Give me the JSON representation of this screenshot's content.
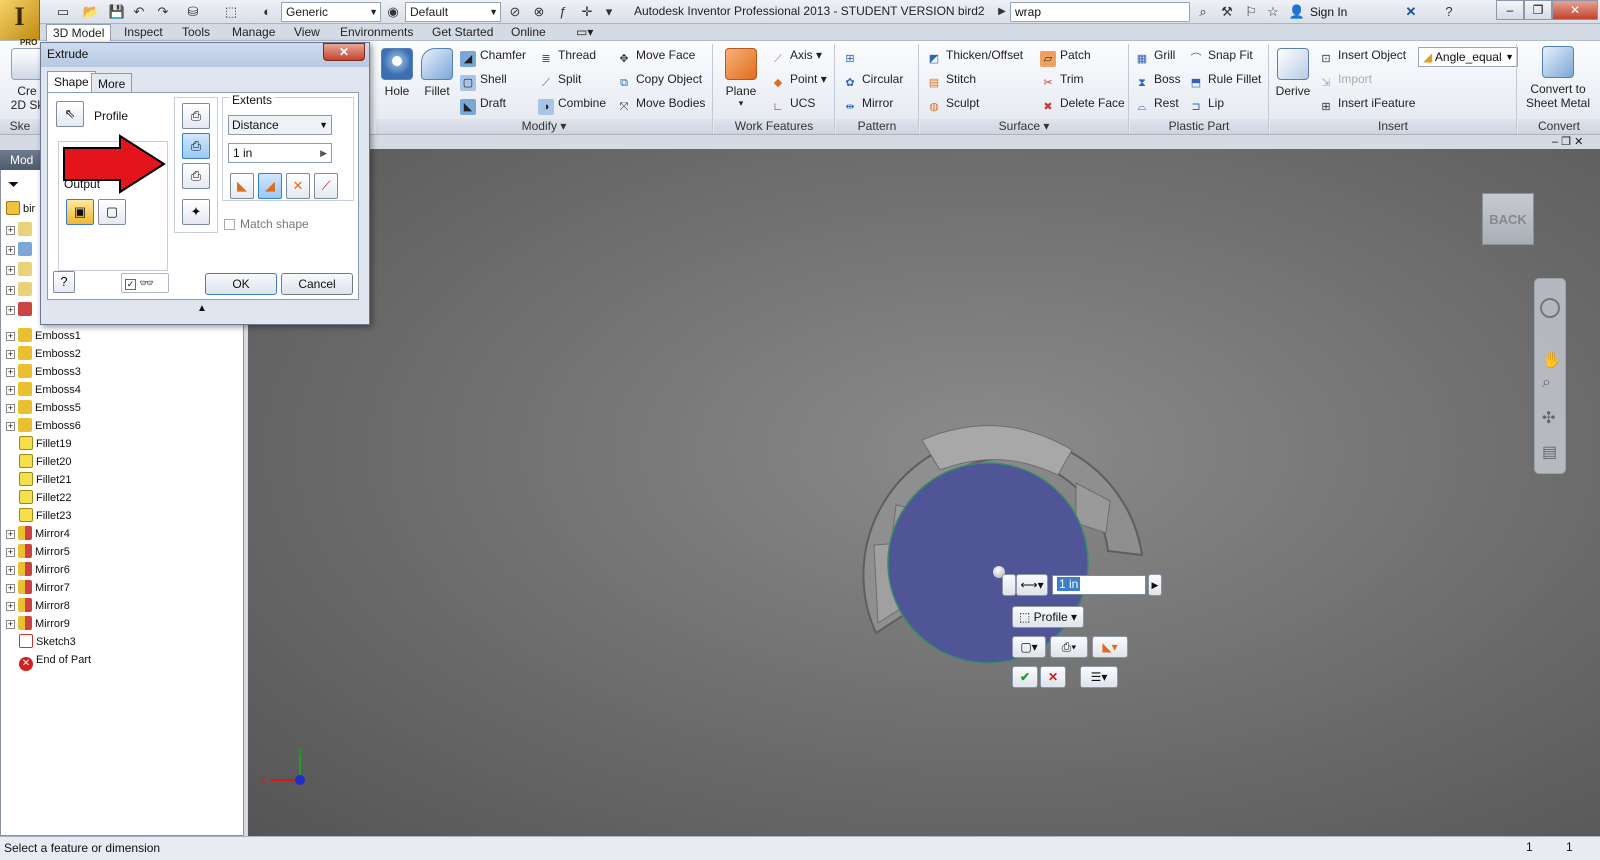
{
  "app": {
    "title": "Autodesk Inventor Professional 2013 - STUDENT VERSION    bird2",
    "logo_letter": "I",
    "logo_sub": "PRO",
    "appearance_combo": "Generic",
    "style_combo": "Default",
    "search_value": "wrap",
    "sign_in": "Sign In",
    "window_buttons": [
      "–",
      "❐",
      "✕"
    ],
    "help": "?"
  },
  "tabs": [
    "3D Model",
    "Inspect",
    "Tools",
    "Manage",
    "View",
    "Environments",
    "Get Started",
    "Online"
  ],
  "ribbon": {
    "sketch_partial": {
      "label1": "Cre",
      "label2": "2D Sk",
      "title": "Ske"
    },
    "modify": {
      "title": "Modify",
      "big": [
        "Hole",
        "Fillet"
      ],
      "col1": [
        "Chamfer",
        "Shell",
        "Draft"
      ],
      "col2": [
        "Thread",
        "Split",
        "Combine"
      ],
      "col3": [
        "Move Face",
        "Copy Object",
        "Move Bodies"
      ]
    },
    "work": {
      "title": "Work Features",
      "big": "Plane",
      "col": [
        "Axis",
        "Point",
        "UCS"
      ]
    },
    "pattern": {
      "title": "Pattern",
      "col": [
        "Circular",
        "Mirror"
      ]
    },
    "surface": {
      "title": "Surface",
      "col1": [
        "Thicken/Offset",
        "Stitch",
        "Sculpt"
      ],
      "col2": [
        "Patch",
        "Trim",
        "Delete Face"
      ]
    },
    "plastic": {
      "title": "Plastic Part",
      "col1": [
        "Grill",
        "Boss",
        "Rest"
      ],
      "col2": [
        "Snap Fit",
        "Rule Fillet",
        "Lip"
      ]
    },
    "insert": {
      "title": "Insert",
      "big": "Derive",
      "col": [
        "Insert Object",
        "Import",
        "Insert iFeature"
      ],
      "combo": "Angle_equal"
    },
    "convert": {
      "title": "Convert",
      "big1": "Convert to",
      "big2": "Sheet Metal"
    }
  },
  "browser": {
    "header": "Mod",
    "root_partial": "bir",
    "items": [
      "Emboss1",
      "Emboss2",
      "Emboss3",
      "Emboss4",
      "Emboss5",
      "Emboss6",
      "Fillet19",
      "Fillet20",
      "Fillet21",
      "Fillet22",
      "Fillet23",
      "Mirror4",
      "Mirror5",
      "Mirror6",
      "Mirror7",
      "Mirror8",
      "Mirror9",
      "Sketch3",
      "End of Part"
    ]
  },
  "dialog": {
    "title": "Extrude",
    "tabs": [
      "Shape",
      "More"
    ],
    "profile_label": "Profile",
    "output_label": "Output",
    "extents_label": "Extents",
    "extents_type": "Distance",
    "distance": "1 in",
    "match_shape": "Match shape",
    "ok": "OK",
    "cancel": "Cancel"
  },
  "viewport": {
    "back_label": "BACK",
    "distance_value": "1 in",
    "profile_button": "Profile",
    "axis_x": "X",
    "axis_y": "Y"
  },
  "status": {
    "message": "Select a feature or dimension",
    "count1": "1",
    "count2": "1"
  },
  "colors": {
    "accent_blue": "#3c7fc9",
    "profile_fill": "#4f5596",
    "arrow_red": "#e3141b"
  }
}
